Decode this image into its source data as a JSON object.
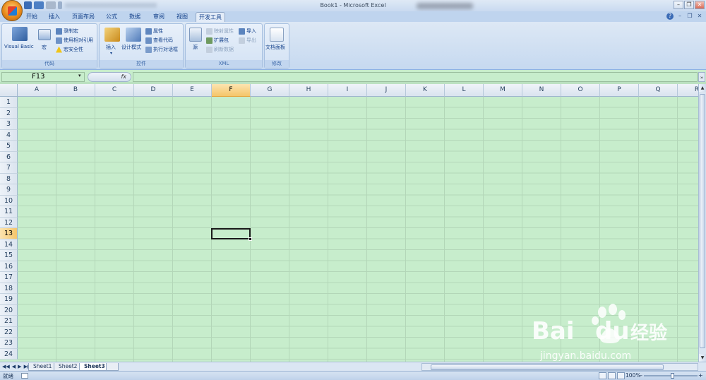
{
  "window": {
    "title": "Book1 - Microsoft Excel"
  },
  "ribbon_tabs": [
    {
      "label": "开始"
    },
    {
      "label": "插入"
    },
    {
      "label": "页面布局"
    },
    {
      "label": "公式"
    },
    {
      "label": "数据"
    },
    {
      "label": "审阅"
    },
    {
      "label": "视图"
    },
    {
      "label": "开发工具"
    }
  ],
  "ribbon": {
    "code_group": {
      "label": "代码",
      "visual_basic": "Visual Basic",
      "macros": "宏",
      "record_macro": "录制宏",
      "relative_ref": "使用相对引用",
      "macro_security": "宏安全性"
    },
    "controls_group": {
      "label": "控件",
      "insert": "插入",
      "design_mode": "设计模式",
      "properties": "属性",
      "view_code": "查看代码",
      "run_dialog": "执行对话框"
    },
    "xml_group": {
      "label": "XML",
      "source": "源",
      "map_properties": "映射属性",
      "expansion_packs": "扩展包",
      "refresh_data": "刷新数据",
      "import": "导入",
      "export": "导出"
    },
    "modify_group": {
      "label": "修改",
      "document_panel": "文档面板"
    }
  },
  "formula_bar": {
    "name_box": "F13",
    "fx": "fx",
    "formula": ""
  },
  "columns": [
    "A",
    "B",
    "C",
    "D",
    "E",
    "F",
    "G",
    "H",
    "I",
    "J",
    "K",
    "L",
    "M",
    "N",
    "O",
    "P",
    "Q",
    "R"
  ],
  "rows": [
    "1",
    "2",
    "3",
    "4",
    "5",
    "6",
    "7",
    "8",
    "9",
    "10",
    "11",
    "12",
    "13",
    "14",
    "15",
    "16",
    "17",
    "18",
    "19",
    "20",
    "21",
    "22",
    "23",
    "24"
  ],
  "selection": {
    "column": "F",
    "row": "13"
  },
  "sheets": [
    {
      "label": "Sheet1"
    },
    {
      "label": "Sheet2"
    },
    {
      "label": "Sheet3"
    }
  ],
  "status": {
    "text": "就绪",
    "zoom": "100%"
  },
  "watermark": {
    "brand": "Bai",
    "brand_suffix": "du",
    "product": "经验",
    "url": "jingyan.baidu.com"
  },
  "colors": {
    "sheet_background": "#c7edcc",
    "ribbon_bg": "#dde8f5",
    "selected_header": "#f5c56a",
    "accent": "#15428b"
  }
}
